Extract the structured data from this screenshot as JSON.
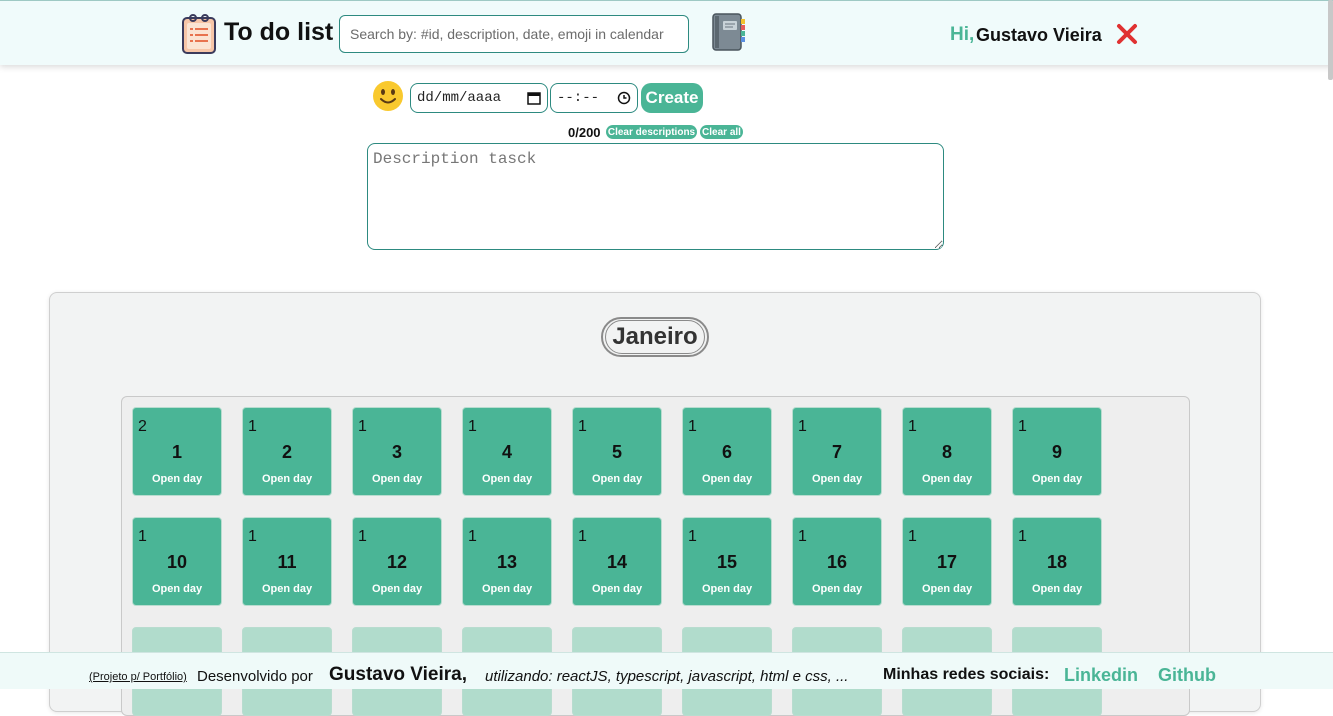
{
  "header": {
    "logo_icon": "clipboard-list-icon",
    "title": "To do list",
    "search_placeholder": "Search by: #id, description, date, emoji in calendar",
    "notebook_icon": "notebook-icon",
    "greeting_hi": "Hi,",
    "user_name": "Gustavo Vieira",
    "logout_icon": "close-x-icon"
  },
  "create_form": {
    "emoji_icon": "slightly-smiling-face-icon",
    "date_placeholder": "dd/mm/aaaa",
    "time_placeholder": "--:--",
    "create_label": "Create",
    "counter": "0/200",
    "clear_descriptions_label": "Clear descriptions",
    "clear_all_label": "Clear all",
    "description_placeholder": "Description tasck"
  },
  "calendar": {
    "month": "Janeiro",
    "open_label": "Open day",
    "days": [
      {
        "day": "1",
        "count": "2"
      },
      {
        "day": "2",
        "count": "1"
      },
      {
        "day": "3",
        "count": "1"
      },
      {
        "day": "4",
        "count": "1"
      },
      {
        "day": "5",
        "count": "1"
      },
      {
        "day": "6",
        "count": "1"
      },
      {
        "day": "7",
        "count": "1"
      },
      {
        "day": "8",
        "count": "1"
      },
      {
        "day": "9",
        "count": "1"
      },
      {
        "day": "10",
        "count": "1"
      },
      {
        "day": "11",
        "count": "1"
      },
      {
        "day": "12",
        "count": "1"
      },
      {
        "day": "13",
        "count": "1"
      },
      {
        "day": "14",
        "count": "1"
      },
      {
        "day": "15",
        "count": "1"
      },
      {
        "day": "16",
        "count": "1"
      },
      {
        "day": "17",
        "count": "1"
      },
      {
        "day": "18",
        "count": "1"
      }
    ]
  },
  "footer": {
    "project_label": "(Projeto p/ Portfólio)",
    "developed_by": "Desenvolvido por",
    "author": "Gustavo Vieira,",
    "using": "utilizando: reactJS, typescript, javascript, html e css, ...",
    "social_label": "Minhas redes sociais:",
    "linkedin": "Linkedin",
    "github": "Github"
  },
  "colors": {
    "accent": "#4ab596",
    "accent_faded": "#b1dccc",
    "close_red": "#e03131"
  }
}
